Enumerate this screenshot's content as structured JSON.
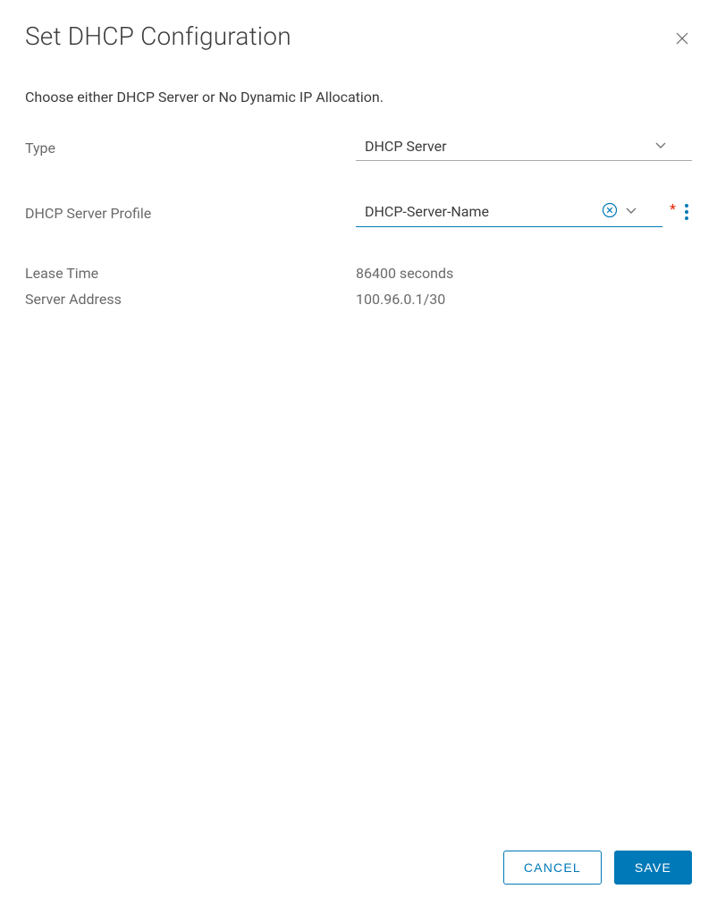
{
  "header": {
    "title": "Set DHCP Configuration"
  },
  "instruction": "Choose either DHCP Server or No Dynamic IP Allocation.",
  "form": {
    "type": {
      "label": "Type",
      "value": "DHCP Server"
    },
    "profile": {
      "label": "DHCP Server Profile",
      "value": "DHCP-Server-Name",
      "required_marker": "*"
    },
    "leaseTime": {
      "label": "Lease Time",
      "value": "86400 seconds"
    },
    "serverAddress": {
      "label": "Server Address",
      "value": "100.96.0.1/30"
    }
  },
  "footer": {
    "cancel": "CANCEL",
    "save": "SAVE"
  }
}
